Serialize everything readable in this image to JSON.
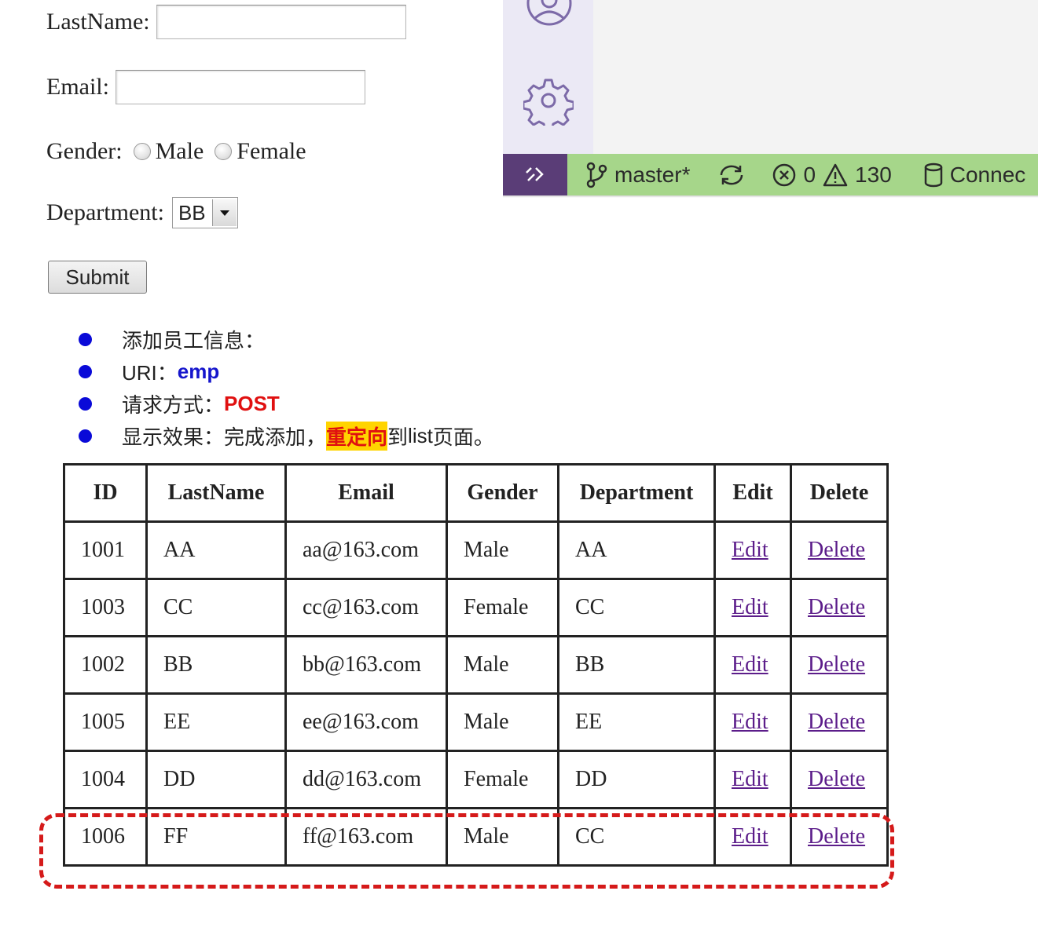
{
  "form": {
    "lastname_label": "LastName:",
    "lastname_value": "",
    "email_label": "Email:",
    "email_value": "",
    "gender_label": "Gender:",
    "gender_options": [
      "Male",
      "Female"
    ],
    "department_label": "Department:",
    "department_value": "BB",
    "submit_label": "Submit"
  },
  "notes": {
    "item1": "添加员工信息：",
    "item2_prefix": "URI：",
    "item2_value": "emp",
    "item3_prefix": "请求方式：",
    "item3_value": "POST",
    "item4_prefix": "显示效果：完成添加，",
    "item4_highlight": "重定向",
    "item4_mid": "到 ",
    "item4_list": "list",
    "item4_suffix": " 页面。"
  },
  "statusbar": {
    "branch": "master*",
    "errors": "0",
    "warnings": "130",
    "connection": "Connec"
  },
  "table": {
    "headers": [
      "ID",
      "LastName",
      "Email",
      "Gender",
      "Department",
      "Edit",
      "Delete"
    ],
    "rows": [
      {
        "id": "1001",
        "lastname": "AA",
        "email": "aa@163.com",
        "gender": "Male",
        "department": "AA",
        "edit": "Edit",
        "delete": "Delete"
      },
      {
        "id": "1003",
        "lastname": "CC",
        "email": "cc@163.com",
        "gender": "Female",
        "department": "CC",
        "edit": "Edit",
        "delete": "Delete"
      },
      {
        "id": "1002",
        "lastname": "BB",
        "email": "bb@163.com",
        "gender": "Male",
        "department": "BB",
        "edit": "Edit",
        "delete": "Delete"
      },
      {
        "id": "1005",
        "lastname": "EE",
        "email": "ee@163.com",
        "gender": "Male",
        "department": "EE",
        "edit": "Edit",
        "delete": "Delete"
      },
      {
        "id": "1004",
        "lastname": "DD",
        "email": "dd@163.com",
        "gender": "Female",
        "department": "DD",
        "edit": "Edit",
        "delete": "Delete"
      },
      {
        "id": "1006",
        "lastname": "FF",
        "email": "ff@163.com",
        "gender": "Male",
        "department": "CC",
        "edit": "Edit",
        "delete": "Delete"
      }
    ]
  },
  "colors": {
    "highlight_box": "#d51a1a",
    "statusbar_bg": "#a6d68a",
    "remote_bg": "#5a3d77"
  },
  "icons": [
    "account-icon",
    "settings-gear-icon",
    "remote-icon",
    "git-branch-icon",
    "sync-icon",
    "error-icon",
    "warning-icon",
    "database-icon",
    "bullet-dot-icon"
  ]
}
